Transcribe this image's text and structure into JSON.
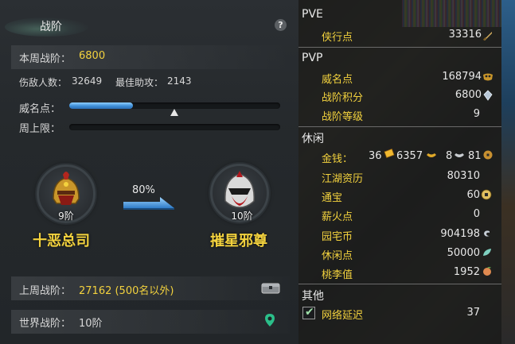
{
  "left_panel": {
    "tab_title": "战阶",
    "help_icon": "?",
    "weekly_rank_label": "本周战阶：",
    "weekly_rank_value": "6800",
    "kills_label": "伤敌人数：",
    "kills_value": "32649",
    "assist_label": "最佳助攻：",
    "assist_value": "2143",
    "prestige_label": "威名点：",
    "prestige_progress": 0.3,
    "weekly_cap_label": "周上限：",
    "weekly_cap_progress": 0.0,
    "current_rank": {
      "level": "9阶",
      "name": "十恶总司",
      "icon": "helmet-icon"
    },
    "next_rank": {
      "level": "10阶",
      "name": "摧星邪尊",
      "icon": "masked-warrior-icon"
    },
    "progress_percent": "80%",
    "last_week_label": "上周战阶：",
    "last_week_value": "27162 (500名以外)",
    "world_rank_label": "世界战阶：",
    "world_rank_value": "10阶"
  },
  "right_panel": {
    "pve_header": "PVE",
    "pve_items": [
      {
        "label": "侠行点",
        "value": "33316",
        "icon": "sword-icon"
      }
    ],
    "pvp_header": "PVP",
    "pvp_items": [
      {
        "label": "威名点",
        "value": "168794",
        "icon": "mask-icon"
      },
      {
        "label": "战阶积分",
        "value": "6800",
        "icon": "crystal-icon"
      },
      {
        "label": "战阶等级",
        "value": "9"
      }
    ],
    "leisure_header": "休闲",
    "money_label": "金钱：",
    "money_gold": "36",
    "money_silver": "6357",
    "money_copper_a": "8",
    "money_copper_b": "81",
    "leisure_items": [
      {
        "label": "江湖资历",
        "value": "80310"
      },
      {
        "label": "通宝",
        "value": "60",
        "icon": "coin-icon"
      },
      {
        "label": "薪火点",
        "value": "0"
      },
      {
        "label": "园宅币",
        "value": "904198",
        "icon": "spiral-coin-icon"
      },
      {
        "label": "休闲点",
        "value": "50000",
        "icon": "leaf-icon"
      },
      {
        "label": "桃李值",
        "value": "1952",
        "icon": "peach-icon"
      }
    ],
    "other_header": "其他",
    "network_label": "网络延迟",
    "network_value": "37",
    "network_checked": true
  },
  "colors": {
    "accent_yellow": "#f3d23e",
    "bar_blue": "#3f8fd8"
  }
}
